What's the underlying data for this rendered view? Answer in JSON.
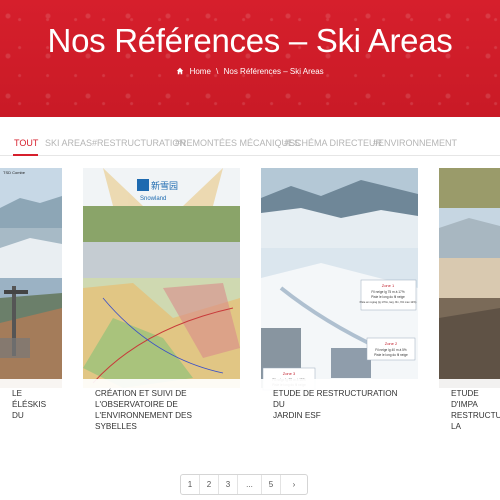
{
  "header": {
    "title": "Nos Références – Ski Areas",
    "breadcrumb_home": "Home",
    "breadcrumb_separator": "\\",
    "breadcrumb_current": "Nos Références – Ski Areas"
  },
  "filters": [
    {
      "label": "TOUT",
      "active": true
    },
    {
      "label": "SKI AREAS",
      "active": false
    },
    {
      "label": "#RESTRUCTURATION",
      "active": false
    },
    {
      "label": "#REMONTÉES MÉCANIQUES",
      "active": false
    },
    {
      "label": "#SCHÉMA DIRECTEUR",
      "active": false
    },
    {
      "label": "#ENVIRONNEMENT",
      "active": false
    }
  ],
  "cards": [
    {
      "caption_line1": "LE",
      "caption_line2": "ÉLÉSKIS DU",
      "caption_line3": "",
      "image_label": "TSD Combe"
    },
    {
      "caption_line1": "CRÉATION ET SUIVI DE",
      "caption_line2": "L'OBSERVATOIRE DE",
      "caption_line3": "L'ENVIRONNEMENT DES SYBELLES",
      "logo_cn": "新雪园",
      "logo_en": "Snowland"
    },
    {
      "caption_line1": "ETUDE DE RESTRUCTURATION DU",
      "caption_line2": "JARDIN ESF",
      "caption_line3": "",
      "zones": [
        {
          "title": "Zone 1",
          "lines": [
            "Fil neige lg 75 m à 17%",
            "Piste le long du fil neige",
            "Piste en regrag (lg 170m, larg. 8m, 6% max 12%)"
          ]
        },
        {
          "title": "Zone 2",
          "lines": [
            "Fil neige lg 40 m à 5%",
            "Piste le long du fil neige"
          ]
        },
        {
          "title": "Zone 3",
          "lines": [
            "Fil neige lg 55 m à 15%",
            "Piste le long du fil neige"
          ]
        }
      ]
    },
    {
      "caption_line1": "ETUDE D'IMPA",
      "caption_line2": "RESTRUCTU",
      "caption_line3": "LA CHAMBRE"
    }
  ],
  "pagination": [
    "1",
    "2",
    "3",
    "...",
    "5",
    "›"
  ],
  "colors": {
    "brand": "#d61f2c",
    "muted": "#b5b5b5"
  }
}
